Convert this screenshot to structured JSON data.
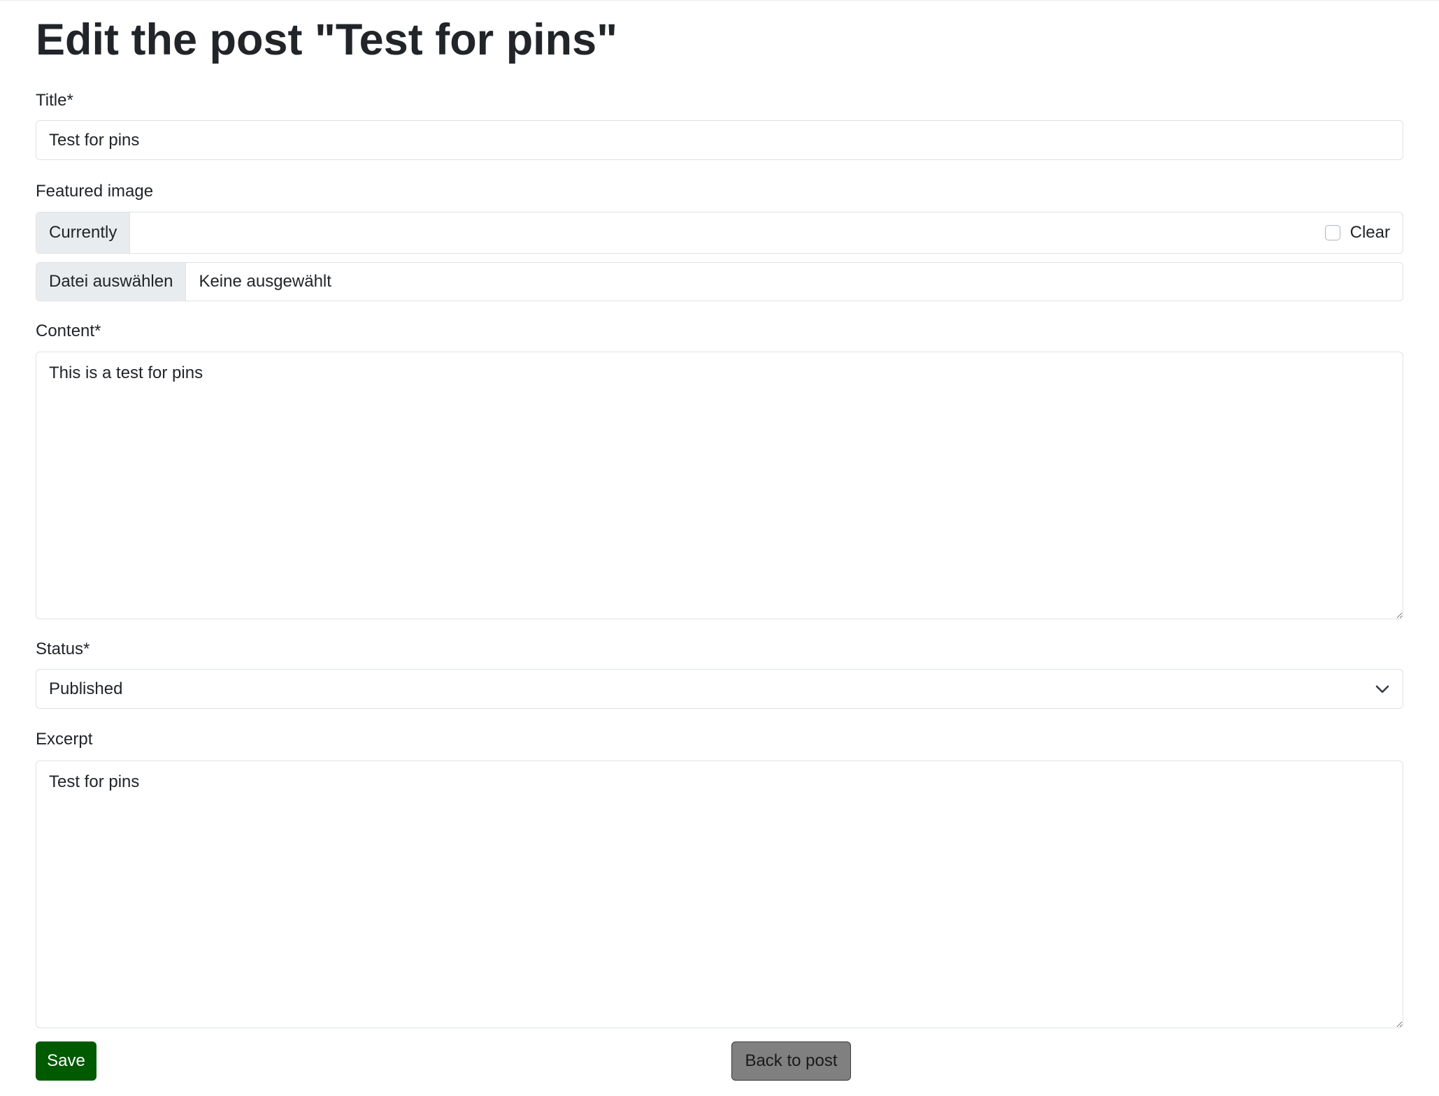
{
  "page_title": "Edit the post \"Test for pins\"",
  "form": {
    "title": {
      "label": "Title*",
      "value": "Test for pins"
    },
    "featured_image": {
      "label": "Featured image",
      "currently_label": "Currently",
      "clear_label": "Clear",
      "clear_checked": false,
      "file_button_label": "Datei auswählen",
      "file_status": "Keine ausgewählt"
    },
    "content": {
      "label": "Content*",
      "value": "This is a test for pins"
    },
    "status": {
      "label": "Status*",
      "selected": "Published"
    },
    "excerpt": {
      "label": "Excerpt",
      "value": "Test for pins"
    }
  },
  "actions": {
    "save_label": "Save",
    "back_label": "Back to post"
  },
  "colors": {
    "save_button_bg": "#005a00",
    "back_button_bg": "#808080",
    "addon_bg": "#e9ecef",
    "border": "#dee2e6"
  },
  "icons": {
    "select_indicator": "chevron-down-icon"
  }
}
